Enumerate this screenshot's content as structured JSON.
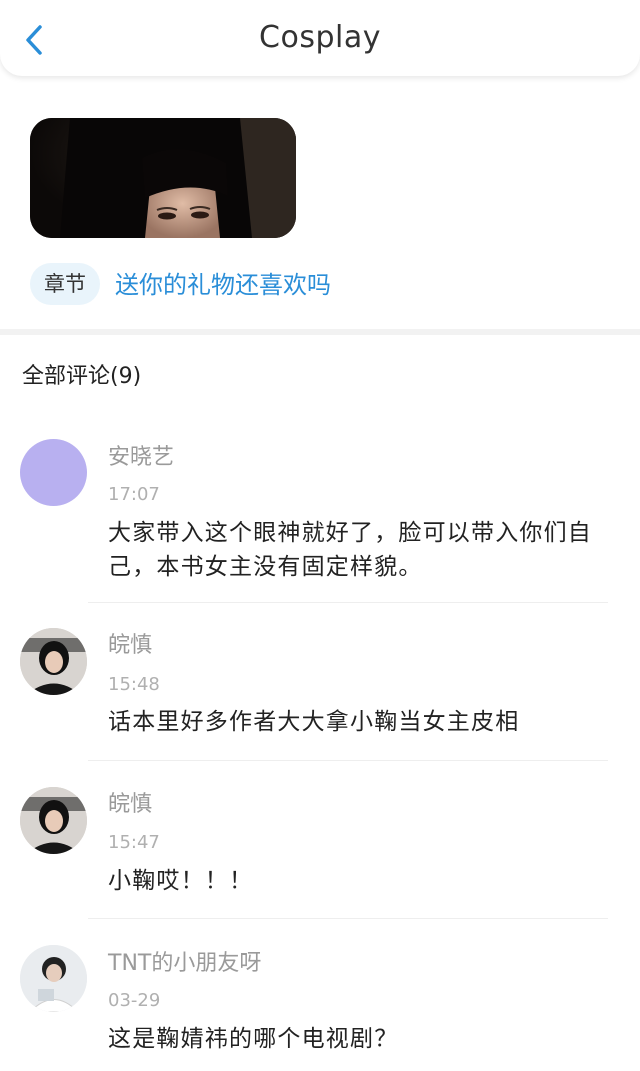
{
  "header": {
    "title": "Cosplay",
    "back_icon": "chevron-left-icon",
    "accent_color": "#2a8ed8"
  },
  "chapter": {
    "badge": "章节",
    "title": "送你的礼物还喜欢吗"
  },
  "comments_header": "全部评论(9)",
  "comments": [
    {
      "username": "安晓艺",
      "time": "17:07",
      "text": "大家带入这个眼神就好了，脸可以带入你们自己，本书女主没有固定样貌。",
      "avatar_color": "#b8b0f0"
    },
    {
      "username": "皖慎",
      "time": "15:48",
      "text": "话本里好多作者大大拿小鞠当女主皮相"
    },
    {
      "username": "皖慎",
      "time": "15:47",
      "text": "小鞠哎！！！"
    },
    {
      "username": "TNT的小朋友呀",
      "time": "03-29",
      "text": "这是鞠婧祎的哪个电视剧？"
    }
  ]
}
